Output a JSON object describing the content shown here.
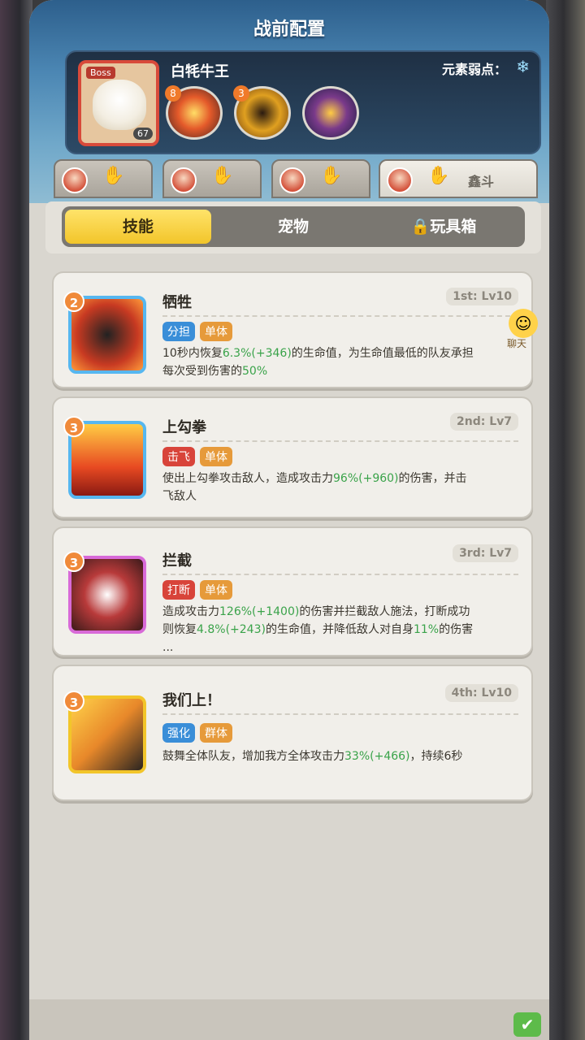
{
  "header": {
    "title": "战前配置",
    "boss_name": "白牦牛王",
    "boss_tag": "Boss",
    "boss_level": "67",
    "weakness_label": "元素弱点：",
    "weakness_icon": "snowflake-icon",
    "boss_skills": [
      {
        "level": "8"
      },
      {
        "level": "3"
      },
      {
        "level": ""
      }
    ]
  },
  "hero_tabs": [
    {
      "label": ""
    },
    {
      "label": ""
    },
    {
      "label": ""
    },
    {
      "label": "鑫斗"
    }
  ],
  "tabs": {
    "skills": "技能",
    "pets": "宠物",
    "toybox": "玩具箱"
  },
  "chat": {
    "label": "聊天"
  },
  "skills": [
    {
      "num": "2",
      "name": "牺牲",
      "level": "1st: Lv10",
      "tags": [
        "分担",
        "单体"
      ],
      "desc_pre": "10秒内恢复",
      "desc_h1": "6.3%",
      "desc_h2": "(+346)",
      "desc_mid": "的生命值，为生命值最低的队友承担",
      "desc_line2_pre": "每次受到伤害的",
      "desc_line2_h": "50%"
    },
    {
      "num": "3",
      "name": "上勾拳",
      "level": "2nd: Lv7",
      "tags": [
        "击飞",
        "单体"
      ],
      "desc_pre": "使出上勾拳攻击敌人，造成攻击力",
      "desc_h1": "96%",
      "desc_h2": "(+960)",
      "desc_mid": "的伤害，并击",
      "desc_line2_pre": "飞敌人"
    },
    {
      "num": "3",
      "name": "拦截",
      "level": "3rd: Lv7",
      "tags": [
        "打断",
        "单体"
      ],
      "desc_pre": "造成攻击力",
      "desc_h1": "126%",
      "desc_h2": "(+1400)",
      "desc_mid": "的伤害并拦截敌人施法，打断成功",
      "desc_line2_pre": "则恢复",
      "desc_line2_h": "4.8%",
      "desc_line2_h2": "(+243)",
      "desc_line2_mid": "的生命值，并降低敌人对自身",
      "desc_line2_h3": "11%",
      "desc_line2_post": "的伤害",
      "desc_line3": "..."
    },
    {
      "num": "3",
      "name": "我们上！",
      "level": "4th: Lv10",
      "tags": [
        "强化",
        "群体"
      ],
      "desc_pre": "鼓舞全体队友，增加我方全体攻击力",
      "desc_h1": "33%",
      "desc_h2": "(+466)",
      "desc_mid": "，持续6秒"
    }
  ],
  "colors": {
    "accent_yellow": "#f2c52a",
    "tag_blue": "#3a8ed8",
    "tag_orange": "#e69a3a",
    "tag_red": "#d8443a",
    "value_green": "#3aa34a"
  }
}
